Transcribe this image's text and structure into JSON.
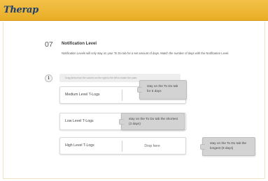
{
  "header": {
    "logo_text": "Therap"
  },
  "step": {
    "number": "07",
    "title": "Notification Level",
    "description": "Notification Levels will only stay on your To Do tab for a set amount of days. Match the number of days with the Notification Level."
  },
  "instruction": {
    "icon": "info-icon",
    "text": "Drag items from the column on the right to the left to match the pairs"
  },
  "targets": [
    {
      "label": "Medium Level T-Logs",
      "drop_text": ""
    },
    {
      "label": "Low Level T-Logs",
      "drop_text": ""
    },
    {
      "label": "High Level T-Logs",
      "drop_text": "Drop here"
    }
  ],
  "cards": [
    {
      "text": "stay on the To Do tab for 5 days"
    },
    {
      "text": "stay on the To Do tab the shortest (3 days)"
    },
    {
      "text": "stay on the To Do tab the longest (8 days)"
    }
  ],
  "colors": {
    "header": "#e8ad25",
    "logo": "#1d3f73",
    "card": "#d3d3d3"
  }
}
